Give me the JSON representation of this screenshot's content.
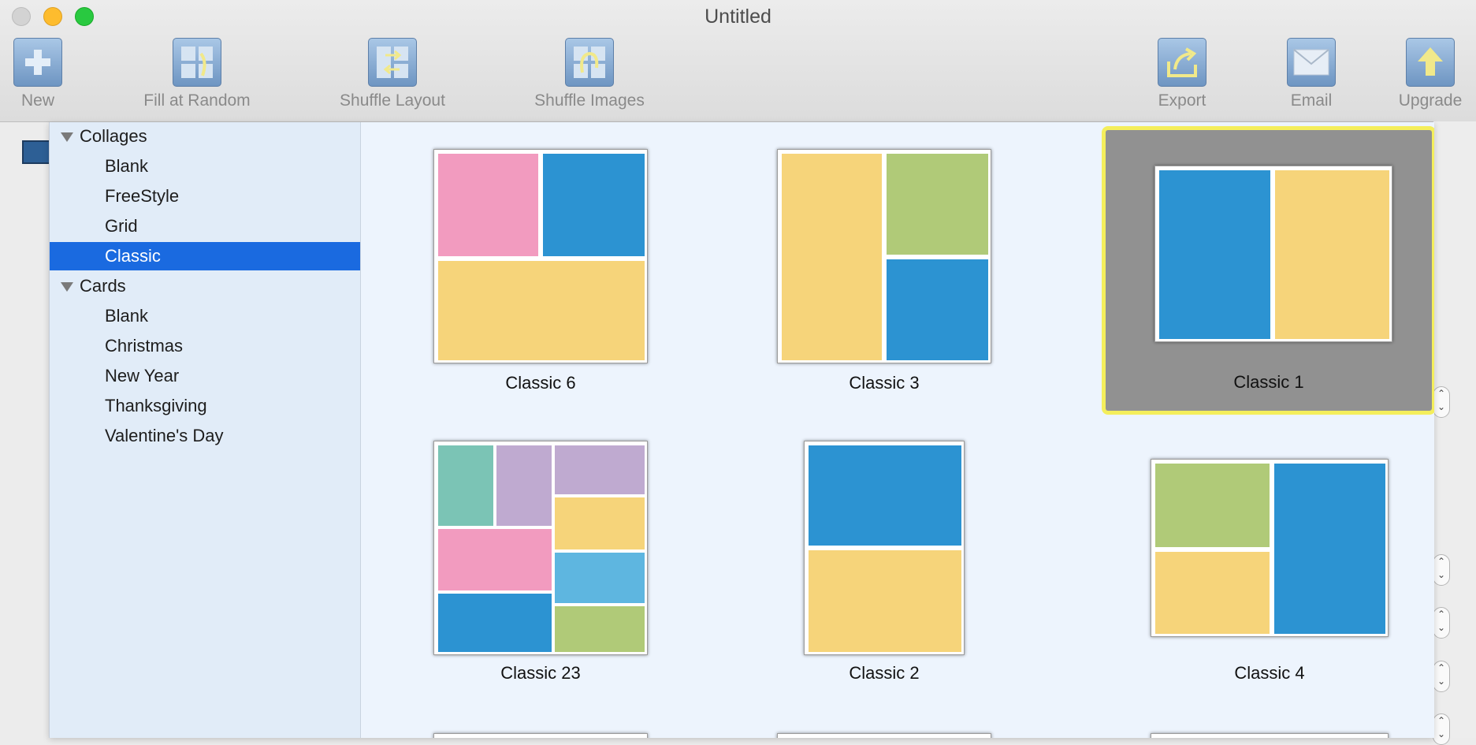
{
  "window": {
    "title": "Untitled"
  },
  "toolbar": {
    "new_label": "New",
    "fill_random_label": "Fill at Random",
    "shuffle_layout_label": "Shuffle Layout",
    "shuffle_images_label": "Shuffle Images",
    "export_label": "Export",
    "email_label": "Email",
    "upgrade_label": "Upgrade"
  },
  "sidebar": {
    "groups": [
      {
        "label": "Collages",
        "items": [
          "Blank",
          "FreeStyle",
          "Grid",
          "Classic"
        ]
      },
      {
        "label": "Cards",
        "items": [
          "Blank",
          "Christmas",
          "New Year",
          "Thanksgiving",
          "Valentine's Day"
        ]
      }
    ],
    "selected": "Classic"
  },
  "colors": {
    "pink": "#f29bbf",
    "blue": "#2c93d2",
    "yellow": "#f6d47a",
    "green": "#b0ca78",
    "teal": "#7bc4b5",
    "purple": "#bfaad0",
    "lightblue": "#5eb6e0",
    "selection": "#1a6ae0",
    "highlight": "#f4ee5c"
  },
  "templates": {
    "classic6": "Classic 6",
    "classic3": "Classic 3",
    "classic1": "Classic 1",
    "classic23": "Classic 23",
    "classic2": "Classic 2",
    "classic4": "Classic 4"
  }
}
